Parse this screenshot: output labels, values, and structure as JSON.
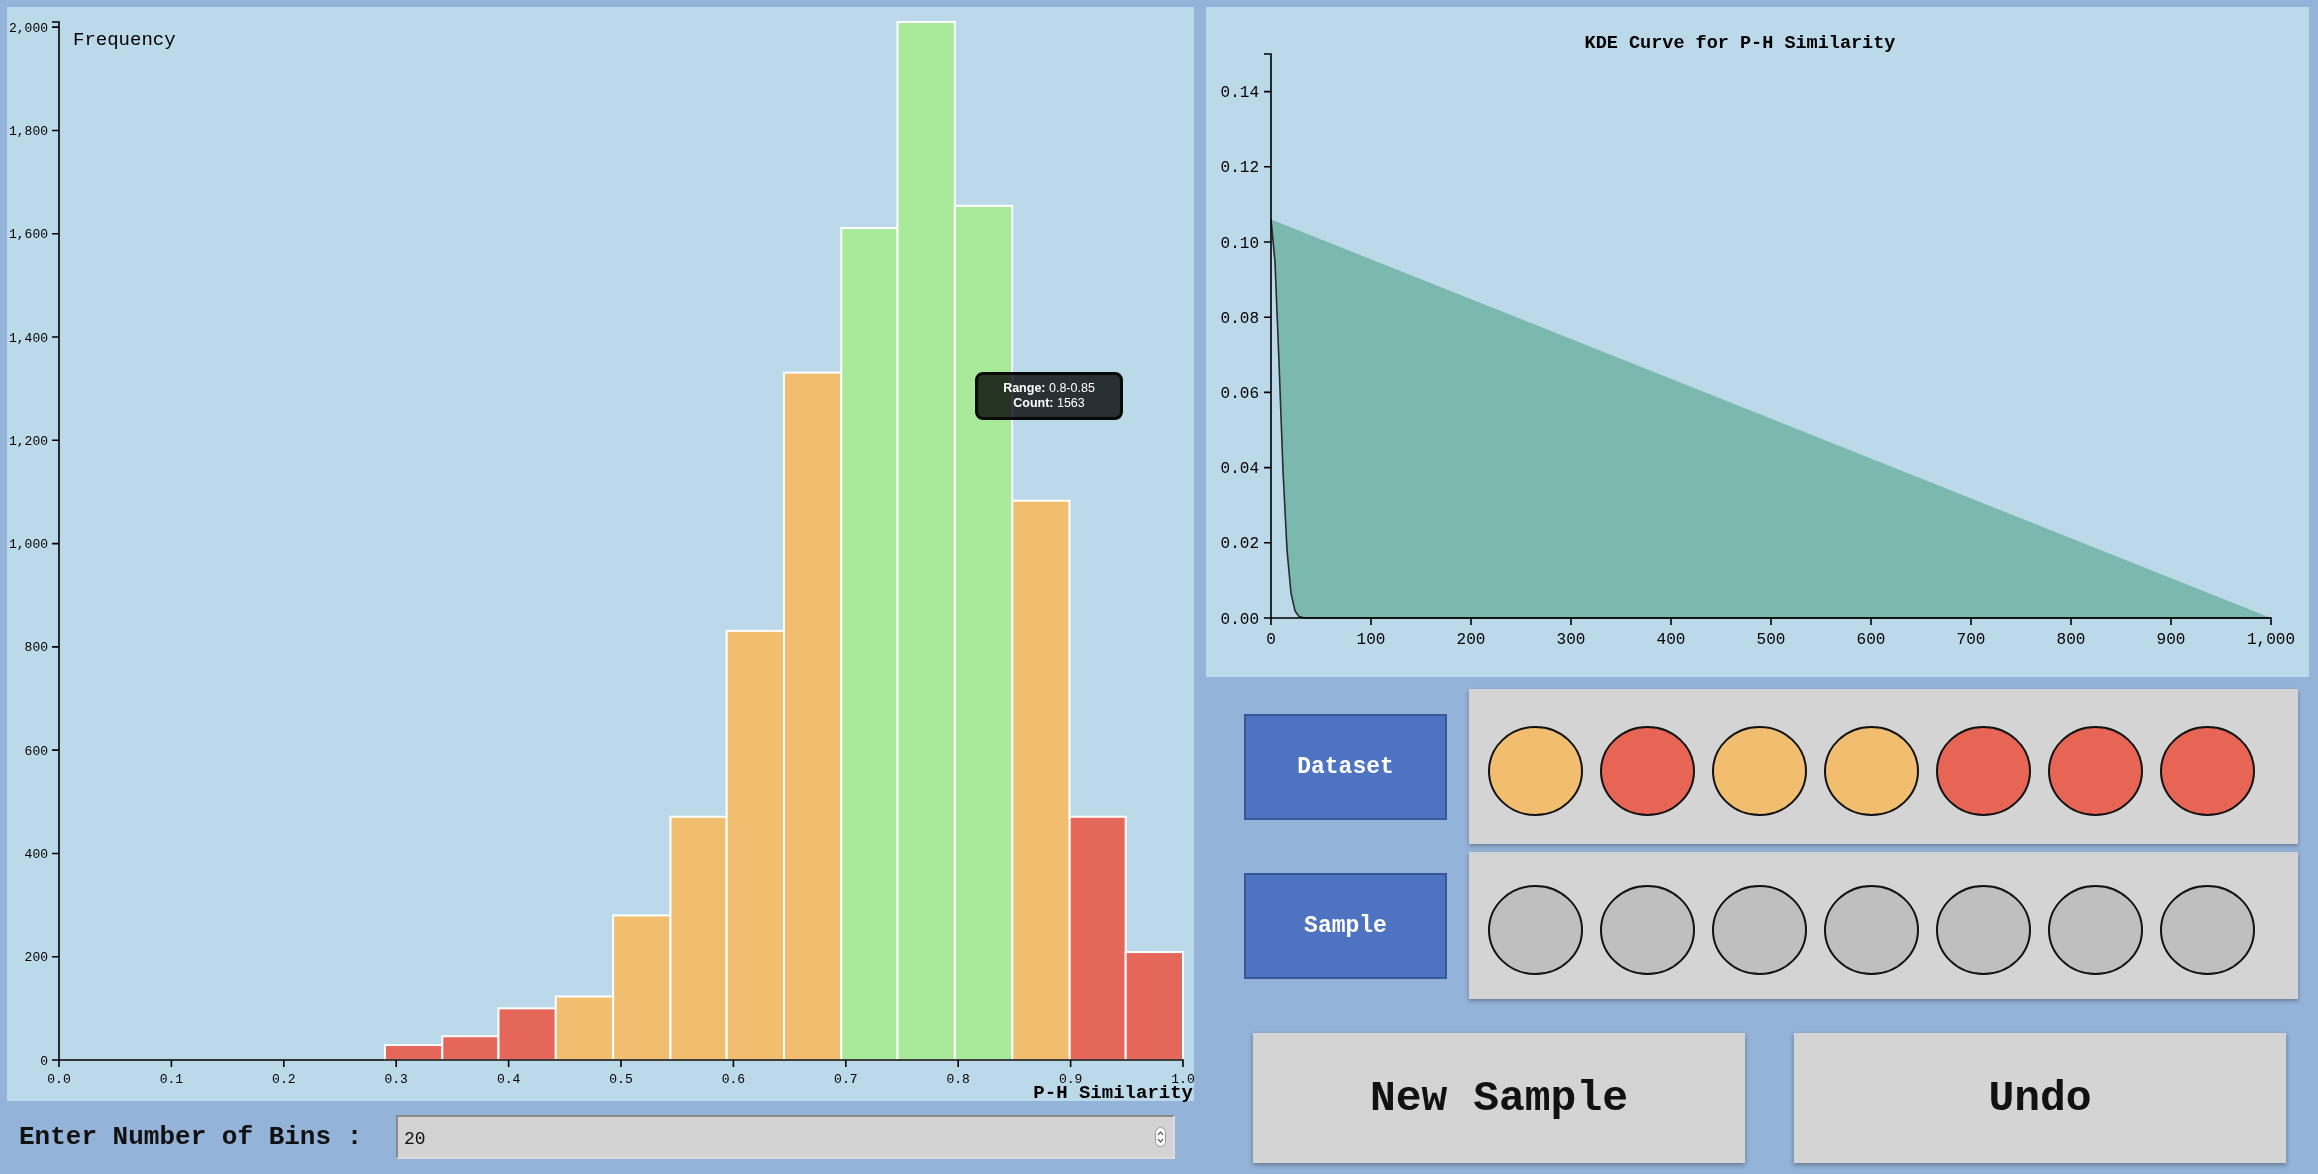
{
  "histogram": {
    "tooltip": {
      "lines": [
        "**Range:** 0.8-0.85",
        "**Count:** 1563"
      ]
    },
    "chart_data": {
      "type": "bar",
      "xlabel": "P-H Similarity",
      "ylabel": "Frequency",
      "x": [
        0.29,
        0.341,
        0.391,
        0.442,
        0.493,
        0.544,
        0.594,
        0.645,
        0.696,
        0.746,
        0.797,
        0.848,
        0.899,
        0.949
      ],
      "series": [
        {
          "color": "#e5675a",
          "values": [
            29,
            46,
            100,
            null,
            null,
            null,
            null,
            null,
            null,
            null,
            null,
            null,
            471,
            209
          ]
        },
        {
          "color": "#f0be6e",
          "values": [
            null,
            null,
            null,
            123,
            280,
            471,
            831,
            1331,
            null,
            null,
            null,
            1083,
            null,
            null
          ]
        },
        {
          "color": "#a8ea9a",
          "values": [
            null,
            null,
            null,
            null,
            null,
            null,
            null,
            null,
            1611,
            2010,
            1654,
            null,
            null,
            null
          ]
        }
      ],
      "xlim": [
        0,
        1
      ],
      "ylim": [
        0,
        2010
      ],
      "xticks": [
        {
          "value": 0,
          "label": "0.0"
        },
        {
          "value": 0.1,
          "label": "0.1"
        },
        {
          "value": 0.2,
          "label": "0.2"
        },
        {
          "value": 0.3,
          "label": "0.3"
        },
        {
          "value": 0.4,
          "label": "0.4"
        },
        {
          "value": 0.5,
          "label": "0.5"
        },
        {
          "value": 0.6,
          "label": "0.6"
        },
        {
          "value": 0.7,
          "label": "0.7"
        },
        {
          "value": 0.8,
          "label": "0.8"
        },
        {
          "value": 0.9,
          "label": "0.9"
        },
        {
          "value": 1,
          "label": "1.0"
        }
      ],
      "yticks": [
        {
          "value": 0,
          "label": "0"
        },
        {
          "value": 200,
          "label": "200"
        },
        {
          "value": 400,
          "label": "400"
        },
        {
          "value": 600,
          "label": "600"
        },
        {
          "value": 800,
          "label": "800"
        },
        {
          "value": 1000,
          "label": "1,000"
        },
        {
          "value": 1200,
          "label": "1,200"
        },
        {
          "value": 1400,
          "label": "1,400"
        },
        {
          "value": 1600,
          "label": "1,600"
        },
        {
          "value": 1800,
          "label": "1,800"
        },
        {
          "value": 2000,
          "label": "2,000"
        }
      ]
    }
  },
  "bins_input": {
    "label": "Enter Number of Bins :",
    "value": "20"
  },
  "kde": {
    "chart_data": {
      "type": "line",
      "title": "KDE Curve for P-H Similarity",
      "x": [
        0,
        4,
        8,
        12,
        16,
        20,
        24,
        28,
        32,
        36,
        40,
        1000
      ],
      "series": [
        {
          "color": "#2b2b2b",
          "values": [
            0.106,
            0.0947,
            0.068,
            0.0392,
            0.0181,
            0.0066,
            0.0019,
            0.0004,
            0.0001,
            0,
            0,
            0
          ]
        }
      ],
      "xlim": [
        0,
        1000
      ],
      "ylim": [
        0,
        0.15
      ],
      "xticks": [
        {
          "value": 0,
          "label": "0"
        },
        {
          "value": 100,
          "label": "100"
        },
        {
          "value": 200,
          "label": "200"
        },
        {
          "value": 300,
          "label": "300"
        },
        {
          "value": 400,
          "label": "400"
        },
        {
          "value": 500,
          "label": "500"
        },
        {
          "value": 600,
          "label": "600"
        },
        {
          "value": 700,
          "label": "700"
        },
        {
          "value": 800,
          "label": "800"
        },
        {
          "value": 900,
          "label": "900"
        },
        {
          "value": 1000,
          "label": "1,000"
        }
      ],
      "yticks": [
        {
          "value": 0,
          "label": "0.00"
        },
        {
          "value": 0.02,
          "label": "0.02"
        },
        {
          "value": 0.04,
          "label": "0.04"
        },
        {
          "value": 0.06,
          "label": "0.06"
        },
        {
          "value": 0.08,
          "label": "0.08"
        },
        {
          "value": 0.1,
          "label": "0.10"
        },
        {
          "value": 0.12,
          "label": "0.12"
        },
        {
          "value": 0.14,
          "label": "0.14"
        }
      ]
    }
  },
  "dataset": {
    "button": "Dataset",
    "circles": [
      {
        "color": "#f0be6e"
      },
      {
        "color": "#e66555"
      },
      {
        "color": "#f0be6e"
      },
      {
        "color": "#f0be6e"
      },
      {
        "color": "#e66555"
      },
      {
        "color": "#e66555"
      },
      {
        "color": "#e66555"
      }
    ]
  },
  "sample": {
    "button": "Sample",
    "circles": [
      {
        "color": "#bfbfbf"
      },
      {
        "color": "#bfbfbf"
      },
      {
        "color": "#bfbfbf"
      },
      {
        "color": "#bfbfbf"
      },
      {
        "color": "#bfbfbf"
      },
      {
        "color": "#bfbfbf"
      },
      {
        "color": "#bfbfbf"
      }
    ]
  },
  "buttons": [
    "New Sample",
    "Undo"
  ]
}
